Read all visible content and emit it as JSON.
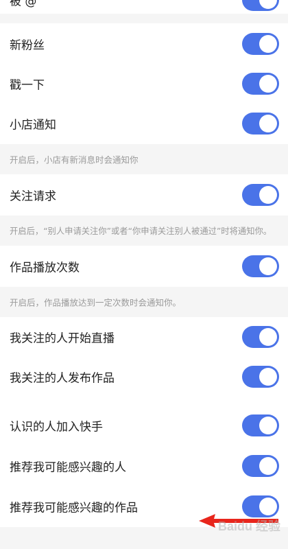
{
  "toggle_color": "#4a73e8",
  "group1": [
    {
      "label": "被 @",
      "on": true
    },
    {
      "label": "新粉丝",
      "on": true
    },
    {
      "label": "戳一下",
      "on": true
    },
    {
      "label": "小店通知",
      "on": true
    }
  ],
  "hint1": "开启后，小店有新消息时会通知你",
  "group2": [
    {
      "label": "关注请求",
      "on": true
    }
  ],
  "hint2": "开启后，“别人申请关注你”或者“你申请关注别人被通过”时将通知你。",
  "group3": [
    {
      "label": "作品播放次数",
      "on": true
    }
  ],
  "hint3": "开启后，作品播放达到一定次数时会通知你。",
  "group4": [
    {
      "label": "我关注的人开始直播",
      "on": true
    },
    {
      "label": "我关注的人发布作品",
      "on": true
    },
    {
      "label": "认识的人加入快手",
      "on": true
    },
    {
      "label": "推荐我可能感兴趣的人",
      "on": true
    },
    {
      "label": "推荐我可能感兴趣的作品",
      "on": true
    }
  ],
  "watermark": "Baidu 经验"
}
